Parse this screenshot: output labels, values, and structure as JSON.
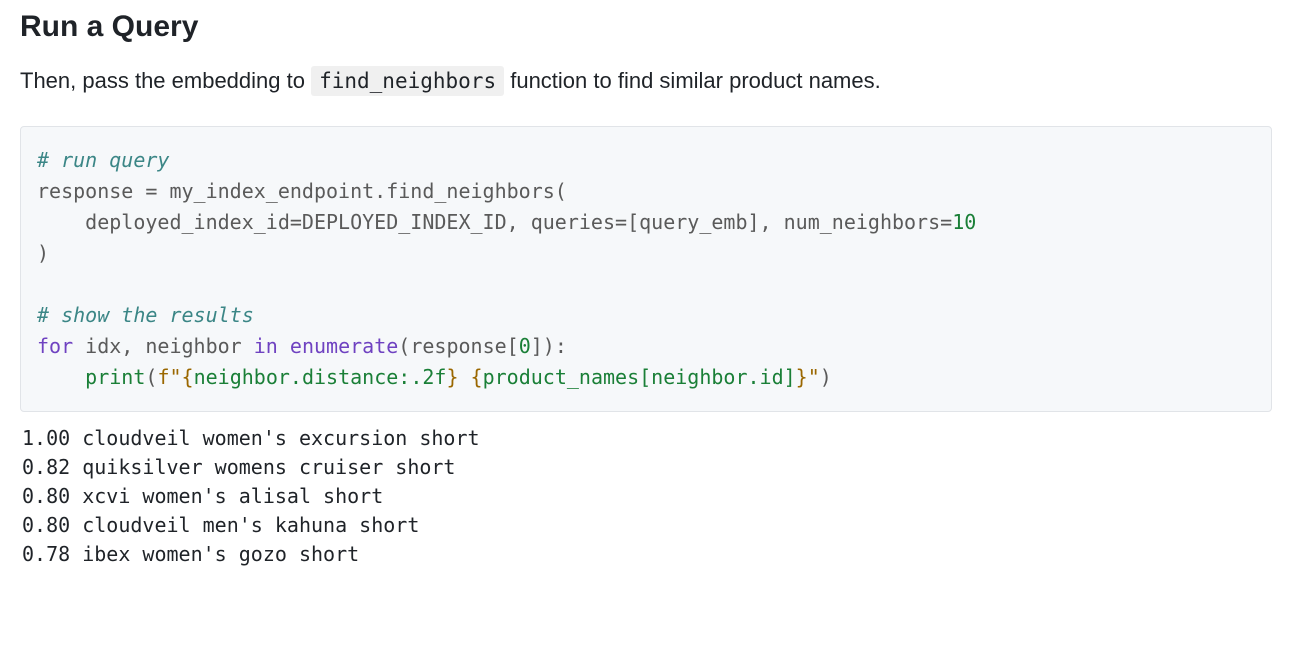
{
  "heading": "Run a Query",
  "description_prefix": "Then, pass the embedding to ",
  "description_code": "find_neighbors",
  "description_suffix": " function to find similar product names.",
  "code": {
    "comment1": "# run query",
    "line2_a": "response ",
    "line2_b": "=",
    "line2_c": " my_index_endpoint",
    "line2_d": ".",
    "line2_e": "find_neighbors",
    "line2_f": "(",
    "line3_a": "    deployed_index_id",
    "line3_b": "=",
    "line3_c": "DEPLOYED_INDEX_ID",
    "line3_d": ", ",
    "line3_e": "queries",
    "line3_f": "=",
    "line3_g": "[",
    "line3_h": "query_emb",
    "line3_i": "], ",
    "line3_j": "num_neighbors",
    "line3_k": "=",
    "line3_l": "10",
    "line4_a": ")",
    "comment2": "# show the results",
    "line6_a": "for",
    "line6_b": " idx",
    "line6_c": ", ",
    "line6_d": "neighbor ",
    "line6_e": "in",
    "line6_f": " ",
    "line6_g": "enumerate",
    "line6_h": "(",
    "line6_i": "response",
    "line6_j": "[",
    "line6_k": "0",
    "line6_l": "]):",
    "line7_a": "    ",
    "line7_b": "print",
    "line7_c": "(",
    "line7_d": "f",
    "line7_e": "\"",
    "line7_f": "{",
    "line7_g": "neighbor.distance",
    "line7_h": ":.2f",
    "line7_i": "}",
    "line7_j": " ",
    "line7_k": "{",
    "line7_l": "product_names[neighbor.id]",
    "line7_m": "}",
    "line7_n": "\"",
    "line7_o": ")"
  },
  "output": "1.00 cloudveil women's excursion short\n0.82 quiksilver womens cruiser short\n0.80 xcvi women's alisal short\n0.80 cloudveil men's kahuna short\n0.78 ibex women's gozo short"
}
